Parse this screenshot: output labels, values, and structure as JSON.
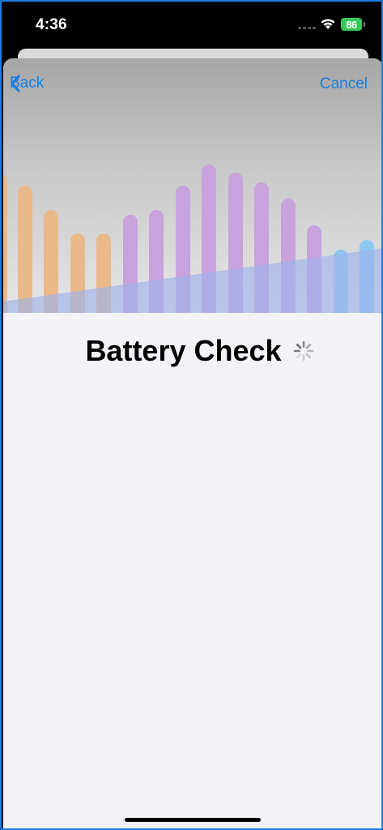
{
  "status_bar": {
    "time": "4:36",
    "battery_level": "86",
    "battery_color": "#34c759"
  },
  "nav": {
    "back_label": "Back",
    "cancel_label": "Cancel",
    "accent_color": "#1a7fe0"
  },
  "hero": {
    "description_icons": [
      "bar-graph-decoration"
    ],
    "bar_colors": {
      "orange": "#e9b98a",
      "purple": "#c7a2dd",
      "blue": "#8cc8f1"
    }
  },
  "main": {
    "title": "Battery Check",
    "loading": true
  }
}
